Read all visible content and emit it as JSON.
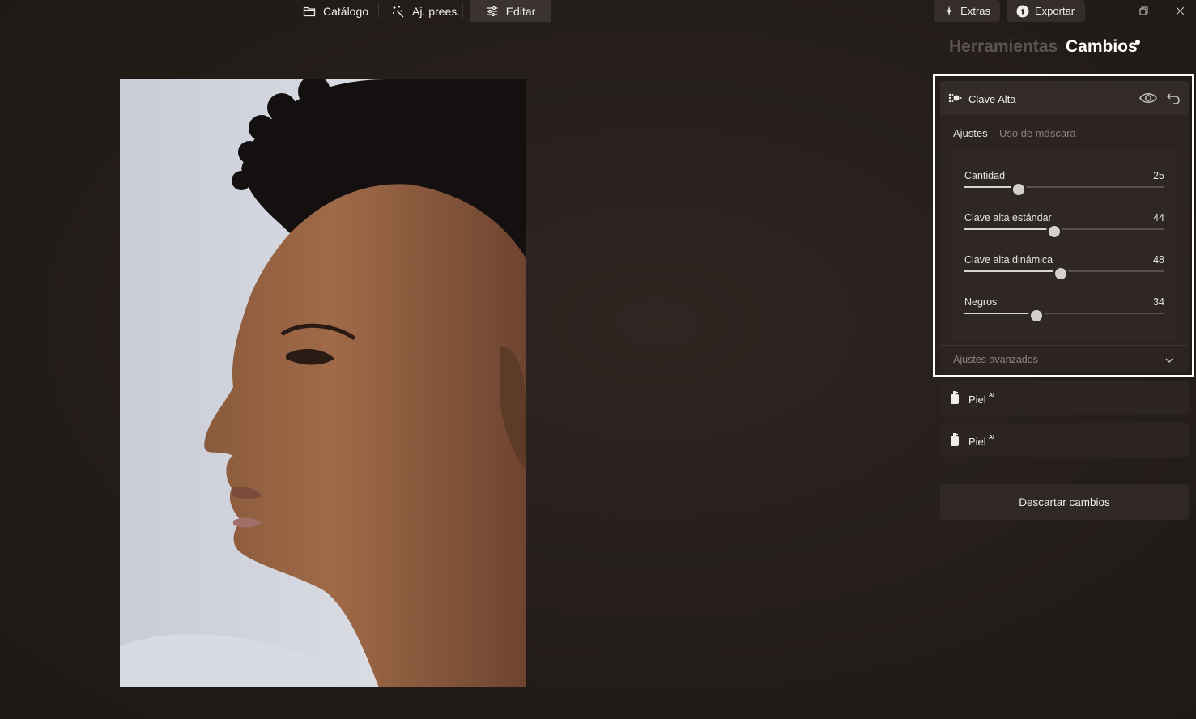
{
  "toolbar": {
    "catalogo": "Catálogo",
    "ajprees": "Aj. prees.",
    "editar": "Editar",
    "extras": "Extras",
    "exportar": "Exportar"
  },
  "panel": {
    "tab_tools": "Herramientas",
    "tab_changes": "Cambios"
  },
  "card": {
    "title": "Clave Alta",
    "subtab_adjust": "Ajustes",
    "subtab_mask": "Uso de máscara",
    "sliders": [
      {
        "label": "Cantidad",
        "value": "25",
        "fraction": 0.27
      },
      {
        "label": "Clave alta estándar",
        "value": "44",
        "fraction": 0.45
      },
      {
        "label": "Clave alta dinámica",
        "value": "48",
        "fraction": 0.48
      },
      {
        "label": "Negros",
        "value": "34",
        "fraction": 0.36
      }
    ],
    "advanced": "Ajustes avanzados"
  },
  "changes": [
    {
      "label": "Piel",
      "badge": "AI"
    },
    {
      "label": "Piel",
      "badge": "AI"
    }
  ],
  "discard": "Descartar cambios",
  "colors": {
    "background": "#261f1b",
    "card": "#2b2421",
    "active_tab": "#ffffff",
    "inactive_tab": "#5c5450"
  }
}
